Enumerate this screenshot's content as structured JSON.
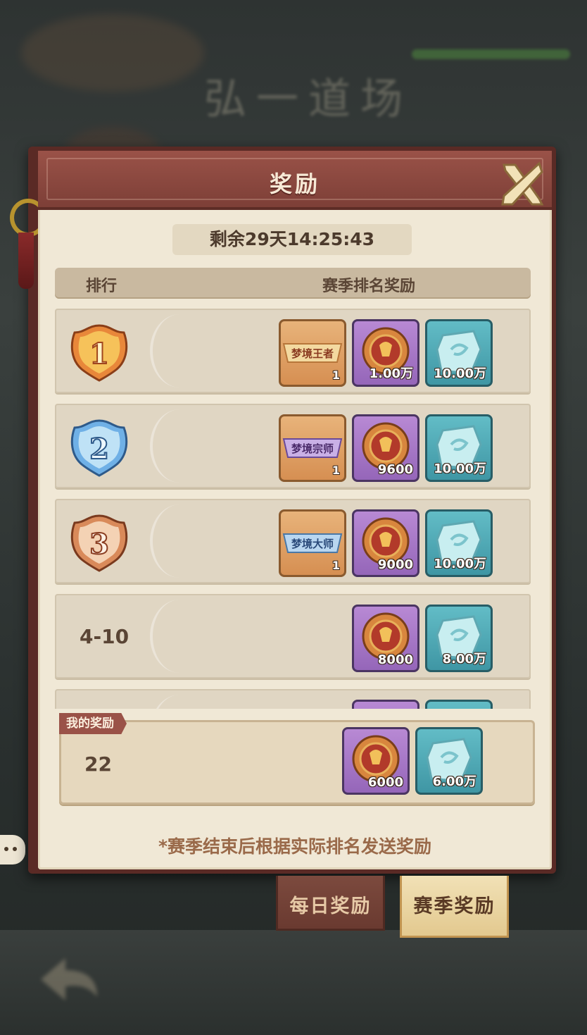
{
  "dialog": {
    "title": "奖励",
    "timer": "剩余29天14:25:43",
    "columns": {
      "rank": "排行",
      "reward": "赛季排名奖励"
    },
    "rows": [
      {
        "rank": "1",
        "rank_display": "medal",
        "medal_color": "#e8873a",
        "items": [
          {
            "icon": "title-badge-icon",
            "badge_text": "梦境王者",
            "quantity": "1",
            "color": "orange"
          },
          {
            "icon": "coin-icon",
            "quantity": "1.00万",
            "color": "purple"
          },
          {
            "icon": "spirit-stone-icon",
            "quantity": "10.00万",
            "color": "teal"
          }
        ]
      },
      {
        "rank": "2",
        "rank_display": "medal",
        "medal_color": "#6fb0e6",
        "items": [
          {
            "icon": "title-badge-icon",
            "badge_text": "梦境宗师",
            "quantity": "1",
            "color": "orange"
          },
          {
            "icon": "coin-icon",
            "quantity": "9600",
            "color": "purple"
          },
          {
            "icon": "spirit-stone-icon",
            "quantity": "10.00万",
            "color": "teal"
          }
        ]
      },
      {
        "rank": "3",
        "rank_display": "medal",
        "medal_color": "#d98a5a",
        "items": [
          {
            "icon": "title-badge-icon",
            "badge_text": "梦境大师",
            "quantity": "1",
            "color": "orange"
          },
          {
            "icon": "coin-icon",
            "quantity": "9000",
            "color": "purple"
          },
          {
            "icon": "spirit-stone-icon",
            "quantity": "10.00万",
            "color": "teal"
          }
        ]
      },
      {
        "rank": "4-10",
        "rank_display": "text",
        "items": [
          {
            "icon": "coin-icon",
            "quantity": "8000",
            "color": "purple"
          },
          {
            "icon": "spirit-stone-icon",
            "quantity": "8.00万",
            "color": "teal"
          }
        ]
      },
      {
        "rank": "",
        "rank_display": "text",
        "items": [
          {
            "icon": "coin-icon",
            "quantity": "",
            "color": "purple"
          },
          {
            "icon": "spirit-stone-icon",
            "quantity": "",
            "color": "teal"
          }
        ]
      }
    ],
    "my_reward": {
      "tag": "我的奖励",
      "rank": "22",
      "items": [
        {
          "icon": "coin-icon",
          "quantity": "6000",
          "color": "purple"
        },
        {
          "icon": "spirit-stone-icon",
          "quantity": "6.00万",
          "color": "teal"
        }
      ]
    },
    "note": "*赛季结束后根据实际排名发送奖励"
  },
  "tabs": [
    {
      "label": "每日奖励",
      "active": false
    },
    {
      "label": "赛季奖励",
      "active": true
    }
  ],
  "colors": {
    "header": "#8a4840",
    "panel": "#f0e8d6",
    "purple_item": "#a678c6",
    "teal_item": "#4fa8b4",
    "orange_item": "#dfa064"
  }
}
